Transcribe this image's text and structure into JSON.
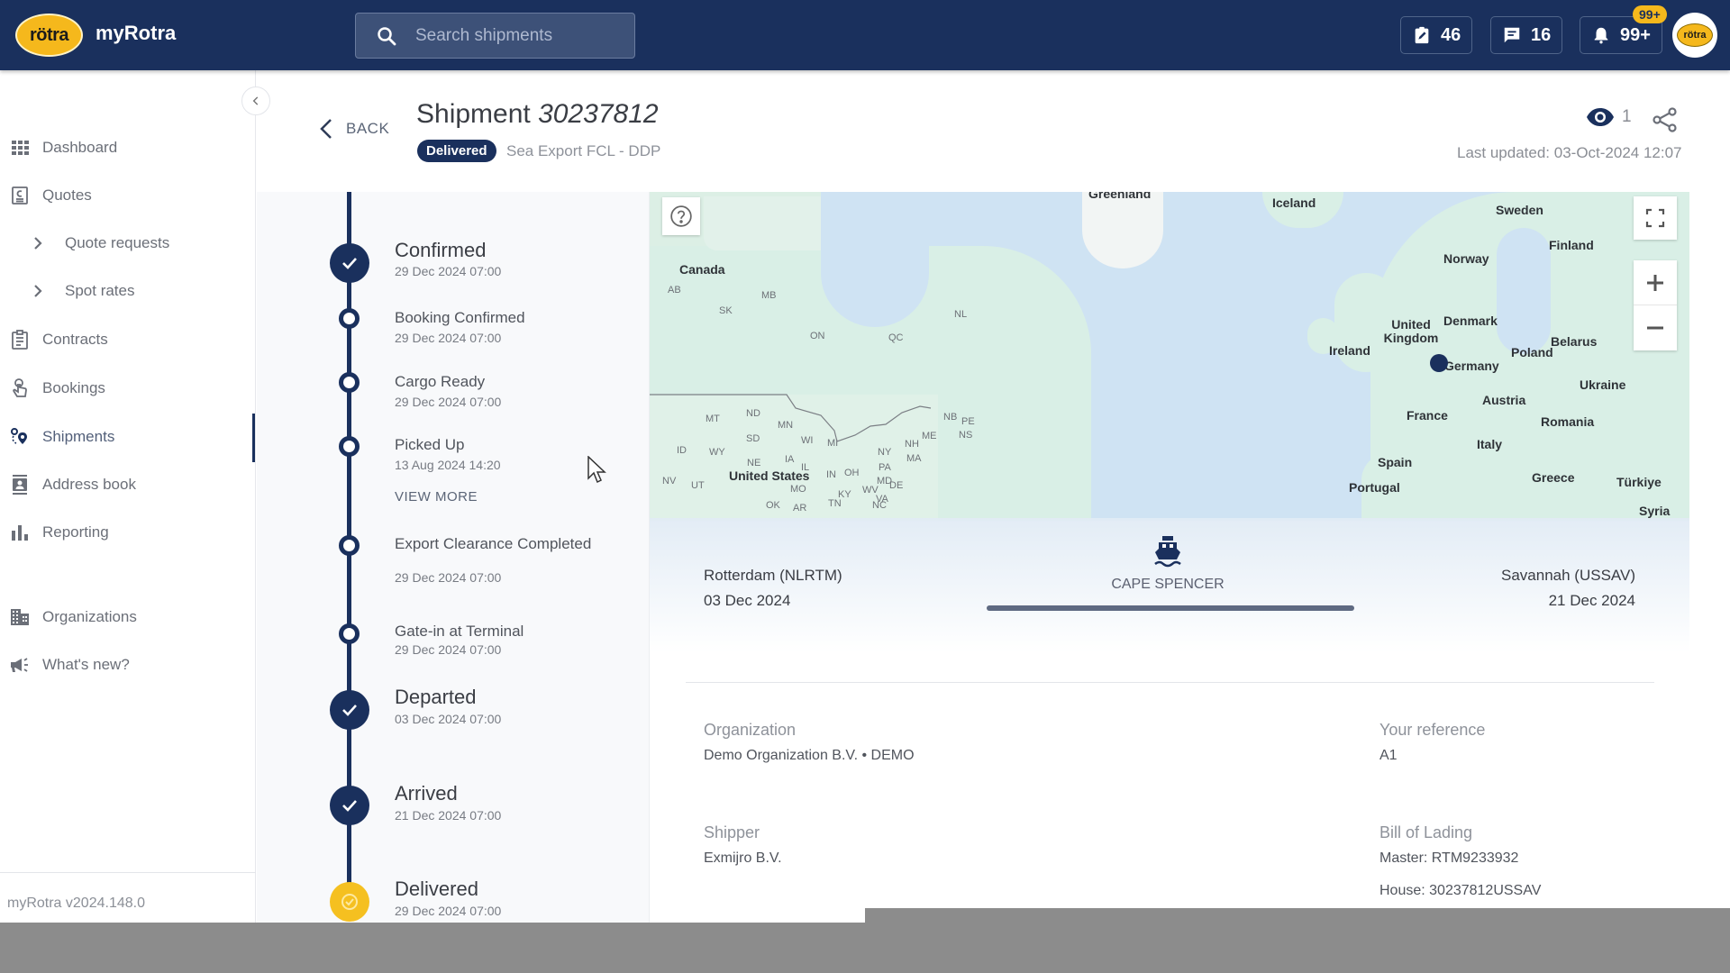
{
  "app": {
    "logo_text": "rötra",
    "name": "myRotra",
    "version": "myRotra v2024.148.0"
  },
  "search": {
    "placeholder": "Search shipments",
    "value": ""
  },
  "topbar": {
    "tasks_count": "46",
    "messages_count": "16",
    "notifications_count": "99+",
    "notifications_badge": "99+",
    "avatar_text": "rötra"
  },
  "sidebar": {
    "items": [
      {
        "label": "Dashboard",
        "icon": "grid-icon"
      },
      {
        "label": "Quotes",
        "icon": "quote-document-icon"
      },
      {
        "label": "Quote requests",
        "icon": "chevron-right-icon"
      },
      {
        "label": "Spot rates",
        "icon": "chevron-right-icon"
      },
      {
        "label": "Contracts",
        "icon": "clipboard-icon"
      },
      {
        "label": "Bookings",
        "icon": "hand-pointer-icon"
      },
      {
        "label": "Shipments",
        "icon": "route-pins-icon",
        "active": true
      },
      {
        "label": "Address book",
        "icon": "contact-card-icon"
      },
      {
        "label": "Reporting",
        "icon": "bar-chart-icon"
      },
      {
        "label": "Organizations",
        "icon": "building-icon"
      },
      {
        "label": "What's new?",
        "icon": "megaphone-icon"
      }
    ]
  },
  "header": {
    "back_label": "BACK",
    "title_prefix": "Shipment",
    "shipment_number": "30237812",
    "status": "Delivered",
    "subtitle": "Sea Export FCL - DDP",
    "viewers": "1",
    "last_updated": "Last updated: 03-Oct-2024 12:07"
  },
  "timeline": {
    "view_more": "VIEW MORE",
    "events": [
      {
        "label": "Confirmed",
        "date": "29 Dec 2024 07:00",
        "type": "milestone"
      },
      {
        "label": "Booking Confirmed",
        "date": "29 Dec 2024 07:00",
        "type": "step"
      },
      {
        "label": "Cargo Ready",
        "date": "29 Dec 2024 07:00",
        "type": "step"
      },
      {
        "label": "Picked Up",
        "date": "13 Aug 2024 14:20",
        "type": "step"
      },
      {
        "label": "Export Clearance Completed",
        "date": "29 Dec 2024 07:00",
        "type": "step"
      },
      {
        "label": "Gate-in at Terminal",
        "date": "29 Dec 2024 07:00",
        "type": "step"
      },
      {
        "label": "Departed",
        "date": "03 Dec 2024 07:00",
        "type": "milestone"
      },
      {
        "label": "Arrived",
        "date": "21 Dec 2024 07:00",
        "type": "milestone"
      },
      {
        "label": "Delivered",
        "date": "29 Dec 2024 07:00",
        "type": "final"
      }
    ]
  },
  "map": {
    "labels": {
      "greenland": "Greenland",
      "iceland": "Iceland",
      "canada": "Canada",
      "united_states": "United States",
      "sweden": "Sweden",
      "finland": "Finland",
      "norway": "Norway",
      "denmark": "Denmark",
      "united_kingdom": "United Kingdom",
      "ireland": "Ireland",
      "germany": "Germany",
      "poland": "Poland",
      "belarus": "Belarus",
      "ukraine": "Ukraine",
      "france": "France",
      "austria": "Austria",
      "romania": "Romania",
      "italy": "Italy",
      "spain": "Spain",
      "portugal": "Portugal",
      "greece": "Greece",
      "turkiye": "Türkiye",
      "syria": "Syria"
    },
    "states": [
      "AB",
      "SK",
      "MB",
      "ON",
      "QC",
      "NL",
      "NB",
      "PE",
      "NS",
      "MT",
      "ND",
      "MN",
      "WI",
      "MI",
      "SD",
      "WY",
      "ID",
      "NE",
      "IA",
      "IL",
      "IN",
      "OH",
      "PA",
      "NY",
      "NH",
      "MA",
      "ME",
      "MD",
      "DE",
      "WV",
      "VA",
      "KY",
      "MO",
      "NV",
      "UT",
      "OK",
      "AR",
      "TN",
      "NC"
    ]
  },
  "route": {
    "origin": "Rotterdam (NLRTM)",
    "origin_date": "03 Dec 2024",
    "destination": "Savannah (USSAV)",
    "destination_date": "21 Dec 2024",
    "vessel": "CAPE SPENCER",
    "progress": 1.0
  },
  "details": {
    "organization_label": "Organization",
    "organization_value": "Demo Organization B.V. • DEMO",
    "reference_label": "Your reference",
    "reference_value": "A1",
    "shipper_label": "Shipper",
    "shipper_value": "Exmijro B.V.",
    "bol_label": "Bill of Lading",
    "bol_master": "Master: RTM9233932",
    "bol_house": "House: 30237812USSAV"
  }
}
